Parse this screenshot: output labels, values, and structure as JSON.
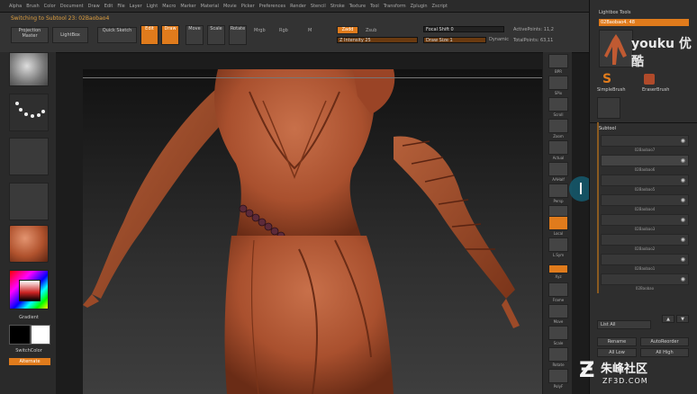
{
  "menu": [
    "Alpha",
    "Brush",
    "Color",
    "Document",
    "Draw",
    "Edit",
    "File",
    "Layer",
    "Light",
    "Macro",
    "Marker",
    "Material",
    "Movie",
    "Picker",
    "Preferences",
    "Render",
    "Stencil",
    "Stroke",
    "Texture",
    "Tool",
    "Transform",
    "Zplugin",
    "Zscript"
  ],
  "top": {
    "switching": "Switching to Subtool 23: 02Baobao4",
    "projection_master": "Projection Master",
    "lightbox": "LightBox",
    "quick_sketch": "Quick Sketch",
    "edit": "Edit",
    "draw": "Draw",
    "move": "Move",
    "scale": "Scale",
    "rotate": "Rotate",
    "mrgb": "Mrgb",
    "rgb": "Rgb",
    "m": "M",
    "zadd": "Zadd",
    "zsub": "Zsub",
    "z_intensity": "Z Intensity 25",
    "focal_shift": "Focal Shift 0",
    "draw_size": "Draw Size 1",
    "dynamic": "Dynamic",
    "active_points": "ActivePoints: 11,2",
    "total_points": "TotalPoints: 63,11"
  },
  "left": {
    "gradient": "Gradient",
    "switch_color": "SwitchColor",
    "alternate": "Alternate"
  },
  "right_shelf": [
    "BPR",
    "SPix",
    "Scroll",
    "Zoom",
    "Actual",
    "AAHalf",
    "Persp",
    "Floor",
    "Local",
    "L.Sym",
    "Xyz",
    "Frame",
    "Move",
    "Scale",
    "Rotate",
    "PolyF",
    "Transp",
    "Solo"
  ],
  "panel": {
    "title": "Lightbox Tools",
    "current_tool": "02Baobao4. 48",
    "watermark": "youku 优酷",
    "simple_brush": "SimpleBrush",
    "eraser_brush": "EraserBrush",
    "subtool": "Subtool",
    "subtools": [
      "02Baobao7",
      "02Baobao6",
      "02Baobao5",
      "02Baobao4",
      "02Baobao3",
      "02Baobao2",
      "02Baobao1",
      "02Baobao"
    ],
    "list_all": "List All",
    "rename": "Rename",
    "auto_reorder": "AutoReorder",
    "all_low": "All Low",
    "all_high": "All High",
    "zf3d": "ZF3D.COM",
    "zf3d_cn": "朱峰社区"
  }
}
